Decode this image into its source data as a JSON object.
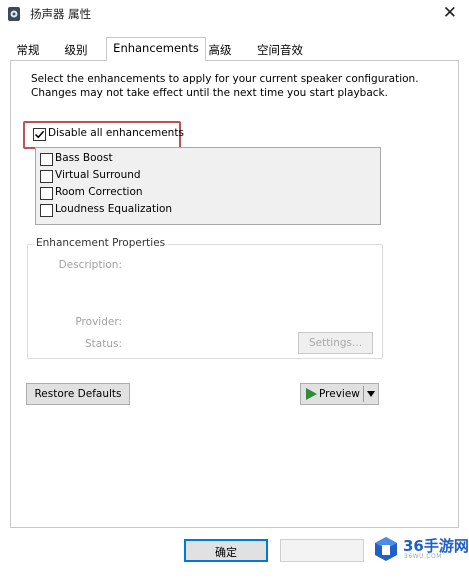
{
  "window": {
    "title": "扬声器 属性",
    "close_glyph": "✕"
  },
  "tabs": [
    {
      "label": "常规",
      "active": false
    },
    {
      "label": "级别",
      "active": false
    },
    {
      "label": "Enhancements",
      "active": true
    },
    {
      "label": "高级",
      "active": false
    },
    {
      "label": "空间音效",
      "active": false
    }
  ],
  "intro_text": "Select the enhancements to apply for your current speaker configuration. Changes may not take effect until the next time you start playback.",
  "disable_all": {
    "label": "Disable all enhancements",
    "checked": true
  },
  "enhancements": [
    {
      "label": "Bass Boost",
      "checked": false
    },
    {
      "label": "Virtual Surround",
      "checked": false
    },
    {
      "label": "Room Correction",
      "checked": false
    },
    {
      "label": "Loudness Equalization",
      "checked": false
    }
  ],
  "properties": {
    "group_title": "Enhancement Properties",
    "description_label": "Description:",
    "provider_label": "Provider:",
    "status_label": "Status:",
    "settings_button": "Settings..."
  },
  "buttons": {
    "restore_defaults": "Restore Defaults",
    "preview": "Preview",
    "ok": "确定"
  },
  "watermark": {
    "text": "36手游网",
    "sub": "36WU.COM"
  },
  "colors": {
    "highlight_border": "#c0505a",
    "ok_focus_border": "#0078d7",
    "preview_play": "#2f8a3a",
    "watermark_blue": "#1e5fc8"
  },
  "icons": {
    "app": "speaker-icon",
    "close": "close-icon",
    "checkmark": "checkmark-icon",
    "play": "play-icon",
    "dropdown": "chevron-down-icon",
    "watermark": "cube-logo"
  }
}
